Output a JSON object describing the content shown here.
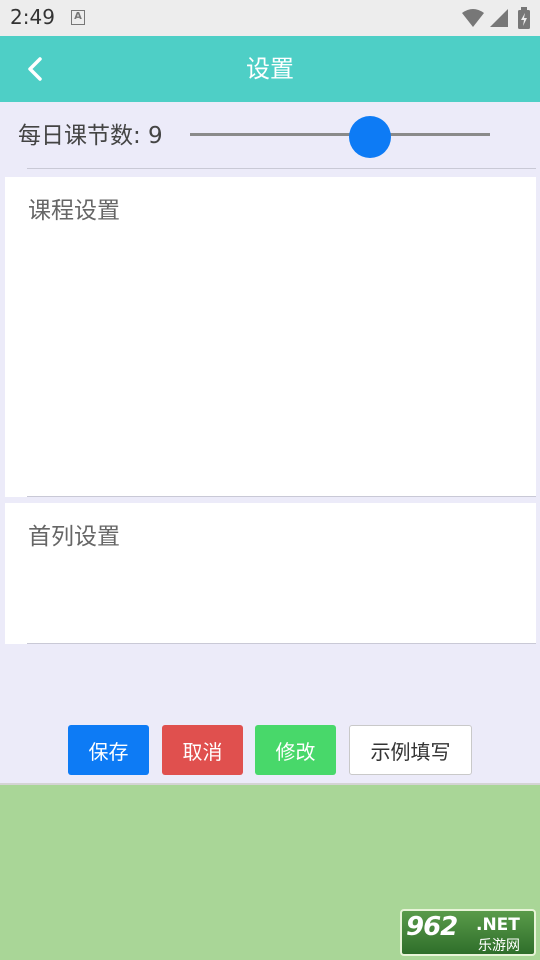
{
  "status_bar": {
    "time": "2:49",
    "notification_icon": "A"
  },
  "header": {
    "title": "设置",
    "back_icon": "chevron-left-icon"
  },
  "lessons": {
    "label": "每日课节数: 9",
    "slider_value": 9,
    "slider_fraction": 0.6
  },
  "course_settings": {
    "placeholder": "课程设置"
  },
  "first_column_settings": {
    "placeholder": "首列设置"
  },
  "buttons": {
    "save": "保存",
    "cancel": "取消",
    "edit": "修改",
    "example": "示例填写"
  },
  "watermark": {
    "number": "962",
    "net": ".NET",
    "site": "乐游网"
  },
  "colors": {
    "header": "#4ecfc6",
    "save": "#0d7bf5",
    "cancel": "#e0504e",
    "edit": "#48d86a",
    "bottom": "#a9d697"
  }
}
